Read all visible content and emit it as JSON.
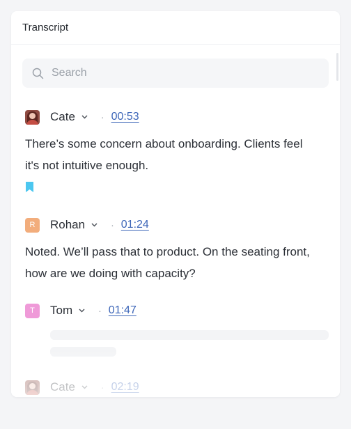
{
  "panel": {
    "title": "Transcript"
  },
  "search": {
    "placeholder": "Search",
    "value": ""
  },
  "entries": [
    {
      "speaker": "Cate",
      "time": "00:53",
      "avatar": "photo",
      "text": "There’s some concern about onboarding. Clients feel it's not intuitive enough.",
      "bookmarked": true
    },
    {
      "speaker": "Rohan",
      "time": "01:24",
      "avatar_letter": "R",
      "avatar_color": "#f2ad7c",
      "text": "Noted. We’ll pass that to product. On the seating front, how are we doing with capacity?"
    },
    {
      "speaker": "Tom",
      "time": "01:47",
      "avatar_letter": "T",
      "avatar_color": "#ef9ad8",
      "text": "",
      "loading": true
    },
    {
      "speaker": "Cate",
      "time": "02:19",
      "avatar": "photo"
    }
  ],
  "colors": {
    "link": "#3d66b8",
    "bookmark": "#4cc7f0",
    "rohan": "#f2ad7c",
    "tom": "#ef9ad8"
  },
  "icons": {
    "search": "search-icon",
    "chevron": "chevron-down-icon",
    "bookmark": "bookmark-icon"
  }
}
